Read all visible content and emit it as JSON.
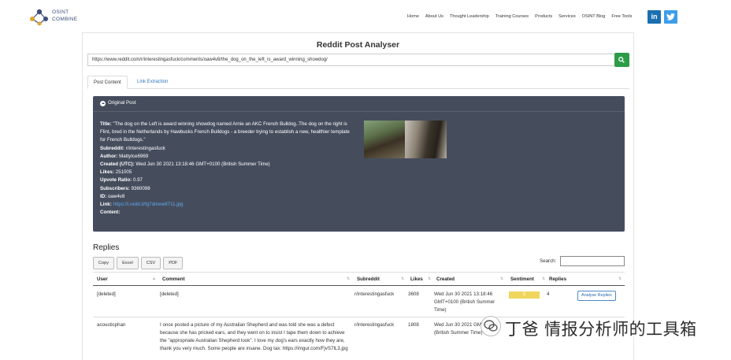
{
  "logo": {
    "line1": "OSINT",
    "line2": "COMBINE"
  },
  "nav": [
    "Home",
    "About Us",
    "Thought Leadership",
    "Training Courses",
    "Products",
    "Services",
    "OSINT Blog",
    "Free Tools"
  ],
  "social": {
    "linkedin": "in",
    "twitter": "t"
  },
  "page_title": "Reddit Post Analyser",
  "url_value": "https://www.reddit.com/r/interestingasfuck/comments/oaw4v8/the_dog_on_the_left_is_award_winning_showdog/",
  "tabs": [
    "Post Content",
    "Link Extraction"
  ],
  "post": {
    "header": "Original Post",
    "title_label": "Title:",
    "title_value": "\"The dog on the Left is award winning showdog named Arnie an AKC French Bulldog..The dog on the right is Flint, bred in the Netherlands by Hawbucks French Bulldogs - a breeder trying to establish a new, healthier template for French Bulldogs.\"",
    "fields": [
      {
        "label": "Subreddit:",
        "value": "r/interestingasfuck"
      },
      {
        "label": "Author:",
        "value": "MattyIce6969"
      },
      {
        "label": "Created (UTC):",
        "value": "Wed Jun 30 2021 13:18:46 GMT+0100 (British Summer Time)"
      },
      {
        "label": "Likes:",
        "value": "251005"
      },
      {
        "label": "Upvote Ratio:",
        "value": "0.97"
      },
      {
        "label": "Subscribers:",
        "value": "9360098"
      },
      {
        "label": "ID:",
        "value": "oaw4v8"
      }
    ],
    "link_label": "Link:",
    "link_value": "https://i.redd.it/fg7dmew8711.jpg",
    "content_label": "Content:"
  },
  "replies": {
    "title": "Replies",
    "buttons": [
      "Copy",
      "Excel",
      "CSV",
      "PDF"
    ],
    "search_label": "Search:",
    "columns": [
      "User",
      "Comment",
      "Subreddit",
      "Likes",
      "Created",
      "Sentiment",
      "Replies"
    ],
    "rows": [
      {
        "user": "[deleted]",
        "comment": "[deleted]",
        "subreddit": "r/interestingasfuck",
        "likes": "3608",
        "created": "Wed Jun 30 2021 13:18:46 GMT+0100 (British Summer Time)",
        "sentiment": "0",
        "replies": "4",
        "action": "Analyse Replies"
      },
      {
        "user": "acousticphan",
        "comment": "I once posted a picture of my Australian Shepherd and was told she was a defect because she has pricked ears, and they went on to insist I tape them down to achieve the \"appropriate Australian Shepherd look\". I love my dog's ears exactly how they are, thank you very much. Some people are insane. Dog tax: https://imgur.com/FjvS7lL3.jpg",
        "subreddit": "r/interestingasfuck",
        "likes": "1808",
        "created": "Wed Jun 30 2021 GMT+0100 (British Summer Time)"
      }
    ]
  },
  "watermark": "丁爸 情报分析师的工具箱"
}
